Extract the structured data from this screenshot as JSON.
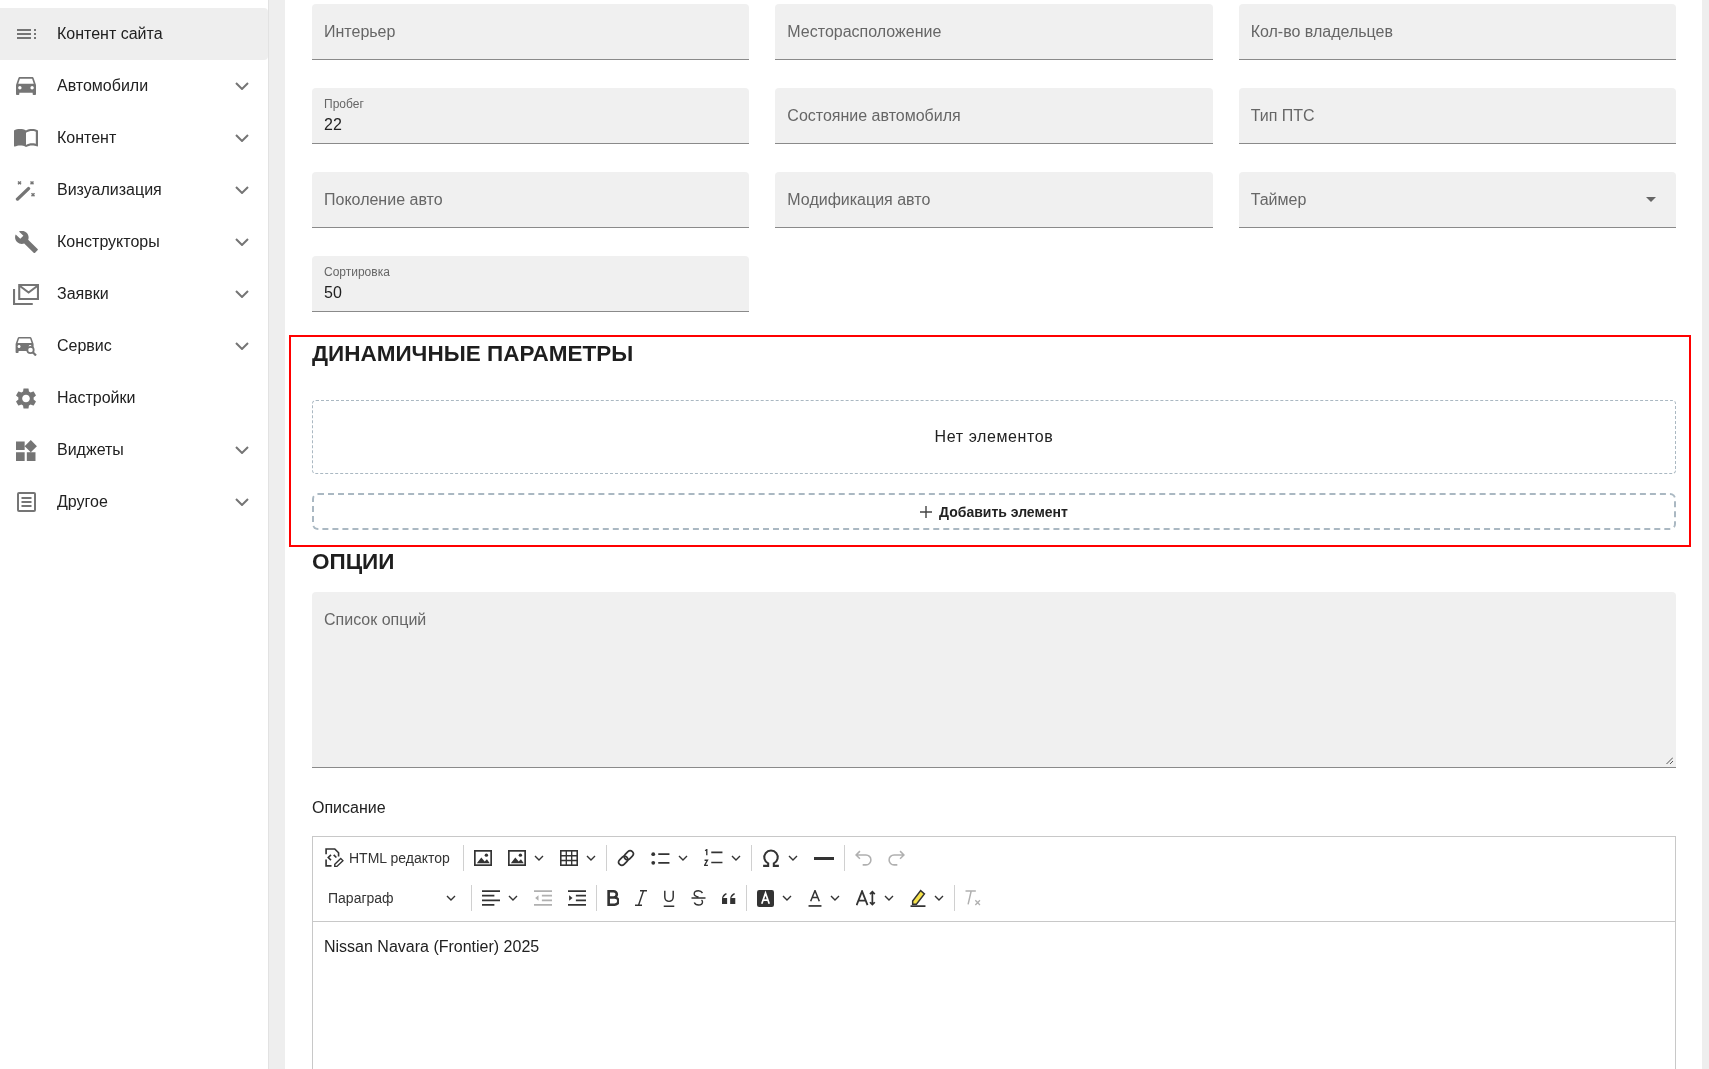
{
  "sidebar": {
    "items": [
      {
        "label": "Контент сайта",
        "selected": true,
        "has_submenu": false
      },
      {
        "label": "Автомобили",
        "selected": false,
        "has_submenu": true
      },
      {
        "label": "Контент",
        "selected": false,
        "has_submenu": true
      },
      {
        "label": "Визуализация",
        "selected": false,
        "has_submenu": true
      },
      {
        "label": "Конструкторы",
        "selected": false,
        "has_submenu": true
      },
      {
        "label": "Заявки",
        "selected": false,
        "has_submenu": true
      },
      {
        "label": "Сервис",
        "selected": false,
        "has_submenu": true
      },
      {
        "label": "Настройки",
        "selected": false,
        "has_submenu": false
      },
      {
        "label": "Виджеты",
        "selected": false,
        "has_submenu": true
      },
      {
        "label": "Другое",
        "selected": false,
        "has_submenu": true
      }
    ]
  },
  "form": {
    "fields": [
      {
        "kind": "text",
        "label": "Интерьер"
      },
      {
        "kind": "text",
        "label": "Месторасположение"
      },
      {
        "kind": "text",
        "label": "Кол-во владельцев"
      },
      {
        "kind": "text",
        "label": "Пробег",
        "value": "22"
      },
      {
        "kind": "text",
        "label": "Состояние автомобиля"
      },
      {
        "kind": "text",
        "label": "Тип ПТС"
      },
      {
        "kind": "text",
        "label": "Поколение авто"
      },
      {
        "kind": "text",
        "label": "Модификация авто"
      },
      {
        "kind": "select",
        "label": "Таймер"
      },
      {
        "kind": "text",
        "label": "Сортировка",
        "value": "50"
      }
    ]
  },
  "dynamic_params": {
    "highlighted": true,
    "title": "ДИНАМИЧНЫЕ ПАРАМЕТРЫ",
    "empty_text": "Нет элементов",
    "add_button": "Добавить элемент"
  },
  "options": {
    "title": "ОПЦИИ",
    "label": "Список опций"
  },
  "description": {
    "label": "Описание",
    "toolbar": [
      [
        [
          {
            "kind": "button",
            "label": "HTML редактор",
            "dropdown": false,
            "disabled": false
          }
        ],
        [
          {
            "kind": "icon",
            "dropdown": false,
            "disabled": false
          },
          {
            "kind": "icon",
            "dropdown": true,
            "disabled": false
          },
          {
            "kind": "icon",
            "dropdown": true,
            "disabled": false
          }
        ],
        [
          {
            "kind": "icon",
            "dropdown": false,
            "disabled": false
          },
          {
            "kind": "icon",
            "dropdown": true,
            "disabled": false
          },
          {
            "kind": "icon",
            "dropdown": true,
            "disabled": false
          }
        ],
        [
          {
            "kind": "icon",
            "dropdown": true,
            "disabled": false
          },
          {
            "kind": "icon",
            "dropdown": false,
            "disabled": false
          }
        ],
        [
          {
            "kind": "icon",
            "dropdown": false,
            "disabled": true
          },
          {
            "kind": "icon",
            "dropdown": false,
            "disabled": true
          }
        ]
      ],
      [
        [
          {
            "kind": "select",
            "label": "Параграф",
            "dropdown": true,
            "disabled": false
          }
        ],
        [
          {
            "kind": "icon",
            "dropdown": true,
            "disabled": false
          },
          {
            "kind": "icon",
            "dropdown": false,
            "disabled": true
          },
          {
            "kind": "icon",
            "dropdown": false,
            "disabled": false
          }
        ],
        [
          {
            "kind": "icon",
            "dropdown": false,
            "disabled": false
          },
          {
            "kind": "icon",
            "dropdown": false,
            "disabled": false
          },
          {
            "kind": "icon",
            "dropdown": false,
            "disabled": false
          },
          {
            "kind": "icon",
            "dropdown": false,
            "disabled": false
          },
          {
            "kind": "icon",
            "dropdown": false,
            "disabled": false
          }
        ],
        [
          {
            "kind": "icon",
            "dropdown": true,
            "disabled": false
          },
          {
            "kind": "icon",
            "dropdown": true,
            "disabled": false
          },
          {
            "kind": "icon",
            "dropdown": true,
            "disabled": false
          },
          {
            "kind": "icon",
            "dropdown": true,
            "disabled": false
          }
        ],
        [
          {
            "kind": "icon",
            "dropdown": false,
            "disabled": true
          }
        ]
      ]
    ],
    "content": "Nissan Navara (Frontier) 2025"
  }
}
